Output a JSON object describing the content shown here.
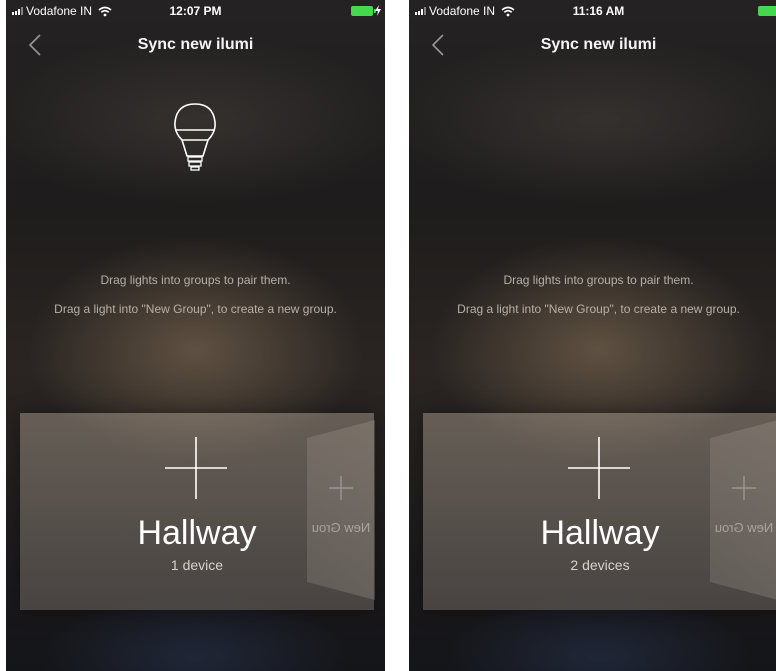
{
  "screens": [
    {
      "status": {
        "carrier": "Vodafone IN",
        "time": "12:07 PM"
      },
      "nav": {
        "title": "Sync new ilumi"
      },
      "instructions": [
        "Drag lights into groups to pair them.",
        "Drag a light into \"New Group\", to create a new group."
      ],
      "group": {
        "name": "Hallway",
        "count": "1 device"
      },
      "new_group": {
        "label": "New Grou",
        "sub": ""
      },
      "show_bulb": true
    },
    {
      "status": {
        "carrier": "Vodafone IN",
        "time": "11:16 AM"
      },
      "nav": {
        "title": "Sync new ilumi"
      },
      "instructions": [
        "Drag lights into groups to pair them.",
        "Drag a light into \"New Group\", to create a new group."
      ],
      "group": {
        "name": "Hallway",
        "count": "2 devices"
      },
      "new_group": {
        "label": "New Grou",
        "sub": ""
      },
      "show_bulb": false
    }
  ],
  "colors": {
    "battery": "#45d84e",
    "accent_text": "#ffffff",
    "instruction_text": "#b7b0a8"
  },
  "icons": [
    "back-chevron-icon",
    "light-bulb-icon",
    "plus-icon",
    "wifi-icon",
    "battery-icon",
    "charging-bolt-icon"
  ]
}
